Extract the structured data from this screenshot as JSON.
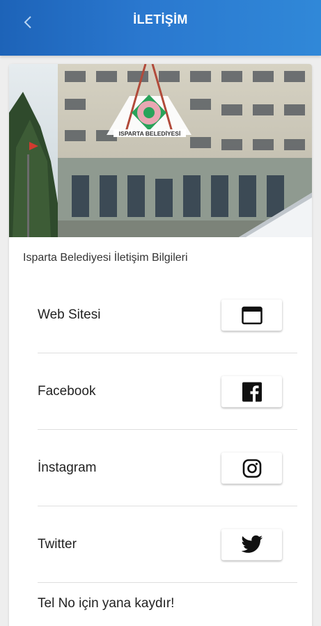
{
  "header": {
    "title": "İLETİŞİM",
    "back_icon": "chevron-left-icon"
  },
  "photo": {
    "logo_text": "ISPARTA BELEDİYESİ"
  },
  "section": {
    "title": "Isparta Belediyesi İletişim Bilgileri"
  },
  "contacts": [
    {
      "label": "Web Sitesi",
      "icon": "browser-window-icon"
    },
    {
      "label": "Facebook",
      "icon": "facebook-icon"
    },
    {
      "label": "İnstagram",
      "icon": "instagram-icon"
    },
    {
      "label": "Twitter",
      "icon": "twitter-icon"
    }
  ],
  "footer": {
    "hint": "Tel No için yana kaydır!"
  },
  "colors": {
    "header_start": "#1d63b8",
    "header_end": "#3088d8",
    "card_bg": "#ffffff",
    "page_bg": "#eeeeee"
  }
}
